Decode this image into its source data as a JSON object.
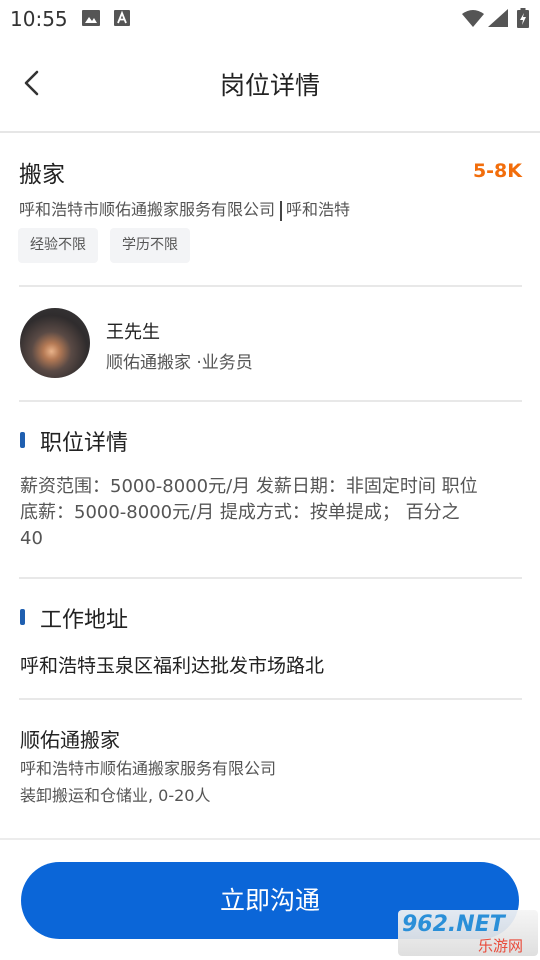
{
  "status_bar": {
    "time": "10:55",
    "icons": [
      "image-icon",
      "a-icon",
      "wifi-icon",
      "signal-icon",
      "battery-icon"
    ]
  },
  "header": {
    "title": "岗位详情"
  },
  "job": {
    "title": "搬家",
    "salary": "5-8K",
    "company": "呼和浩特市顺佑通搬家服务有限公司",
    "city": "呼和浩特",
    "tags": [
      "经验不限",
      "学历不限"
    ]
  },
  "contact": {
    "name": "王先生",
    "role": "顺佑通搬家 ·业务员"
  },
  "detail_section": {
    "title": "职位详情",
    "lines": [
      "薪资范围：5000-8000元/月 发薪日期：非固定时间 职位",
      "底薪：5000-8000元/月 提成方式：按单提成； 百分之",
      "40"
    ]
  },
  "address_section": {
    "title": "工作地址",
    "address": "呼和浩特玉泉区福利达批发市场路北"
  },
  "company_card": {
    "name": "顺佑通搬家",
    "full_name": "呼和浩特市顺佑通搬家服务有限公司",
    "info": "装卸搬运和仓储业, 0-20人"
  },
  "cta": {
    "label": "立即沟通"
  },
  "watermark": {
    "top": "962.NET",
    "bottom": "乐游网"
  },
  "colors": {
    "accent_blue": "#0b66d8",
    "salary_orange": "#f26d0b",
    "section_bar": "#1f5fb0"
  }
}
